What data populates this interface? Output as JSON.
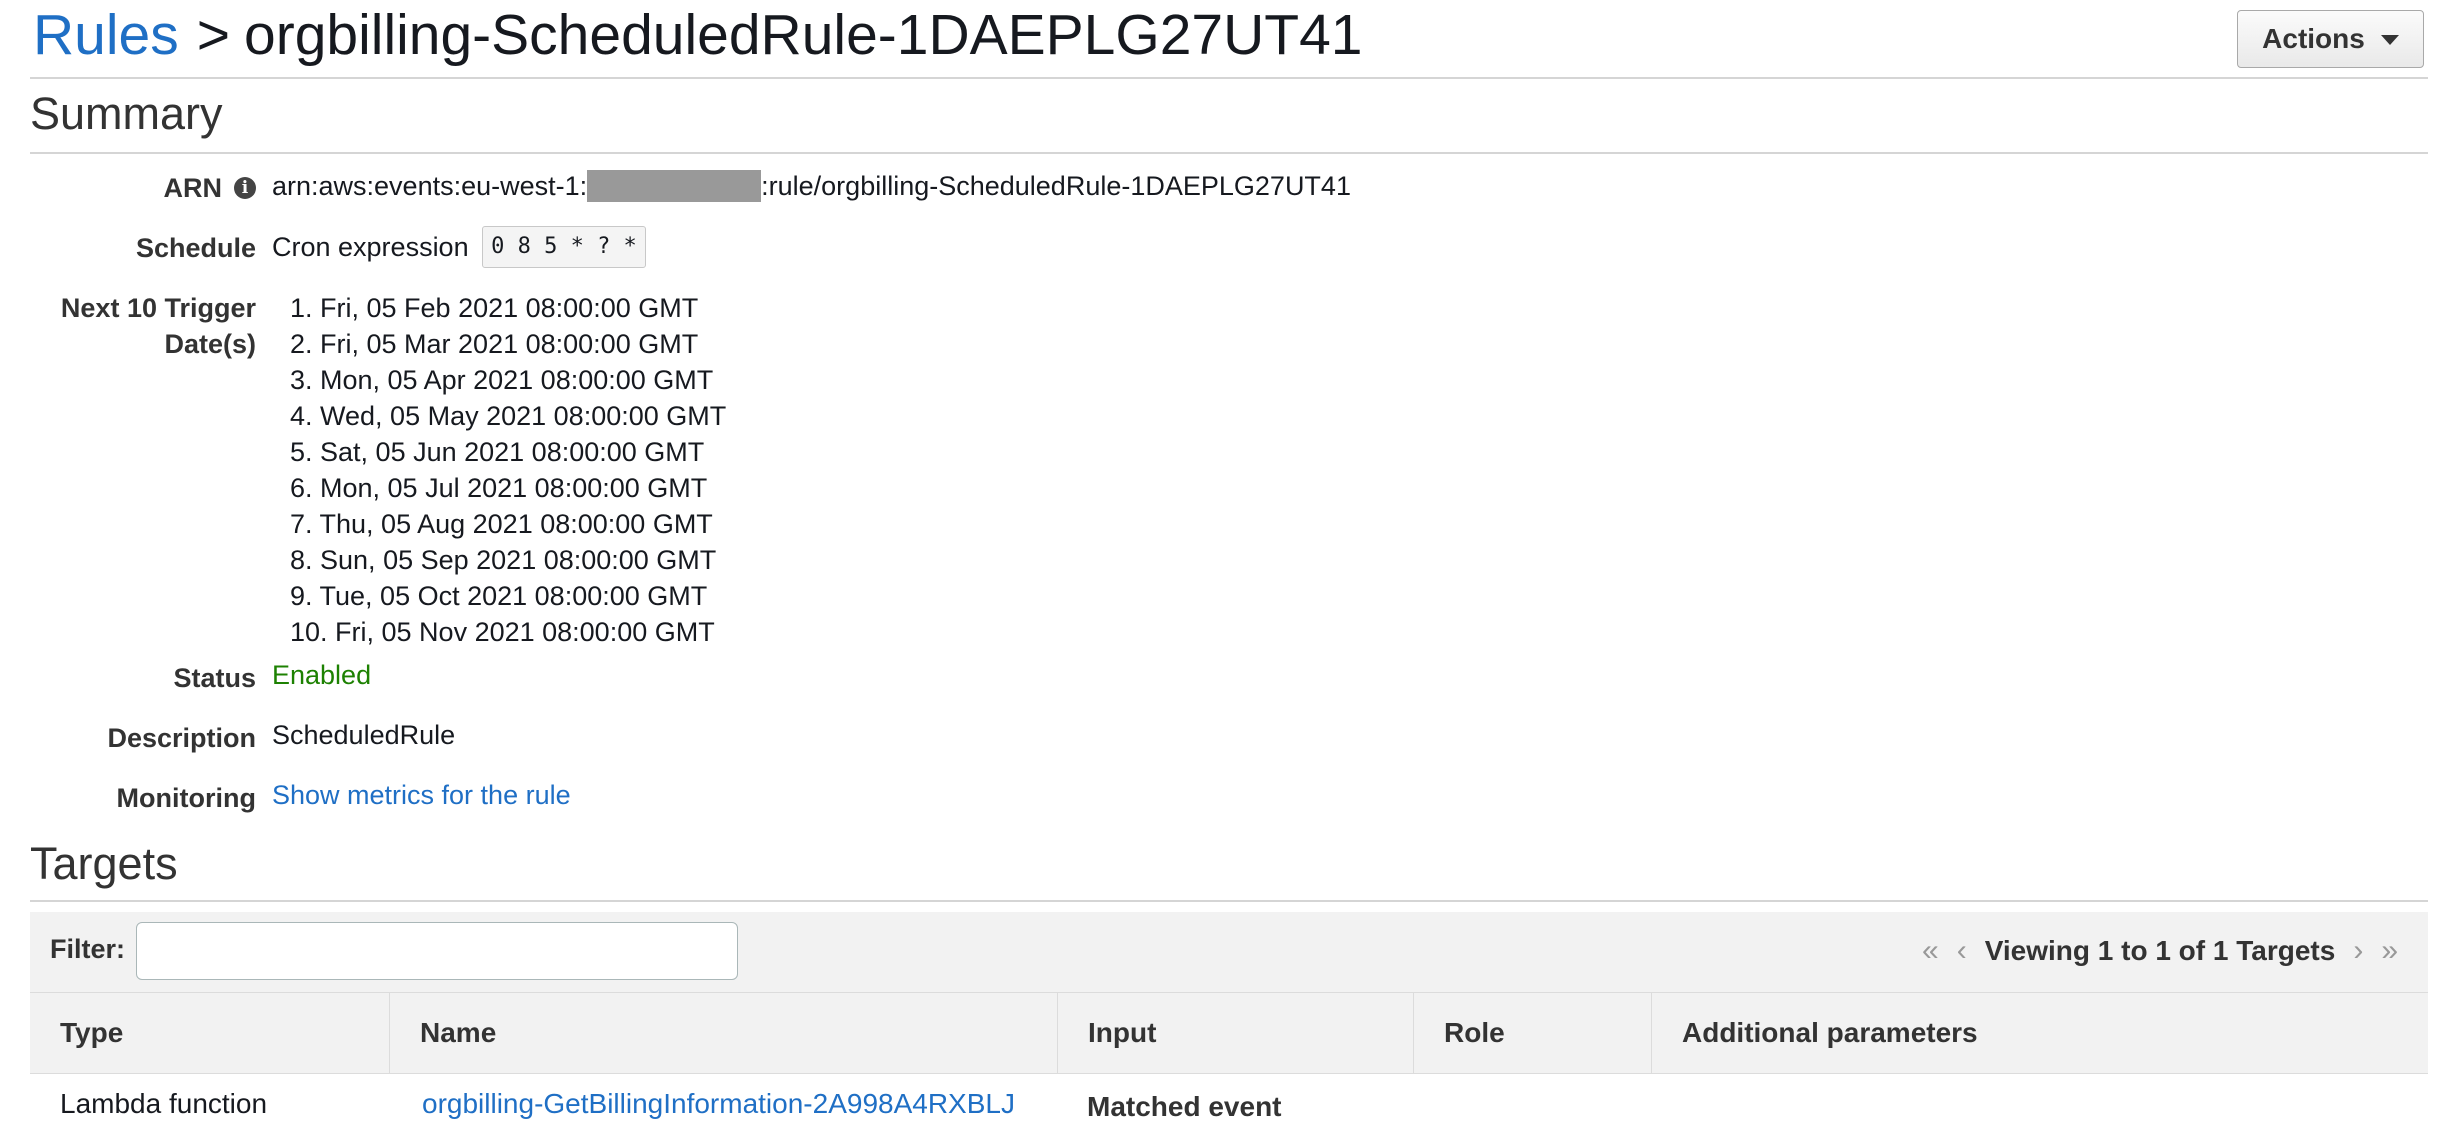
{
  "header": {
    "breadcrumb_root": "Rules",
    "breadcrumb_separator": ">",
    "rule_name": "orgbilling-ScheduledRule-1DAEPLG27UT41",
    "actions_label": "Actions"
  },
  "summary": {
    "title": "Summary",
    "arn": {
      "label": "ARN",
      "prefix": "arn:aws:events:eu-west-1:",
      "suffix": ":rule/orgbilling-ScheduledRule-1DAEPLG27UT41"
    },
    "schedule": {
      "label": "Schedule",
      "text": "Cron expression",
      "cron": "0 8 5 * ? *"
    },
    "triggers": {
      "label_line1": "Next 10 Trigger",
      "label_line2": "Date(s)",
      "dates": [
        "1. Fri, 05 Feb 2021 08:00:00 GMT",
        "2. Fri, 05 Mar 2021 08:00:00 GMT",
        "3. Mon, 05 Apr 2021 08:00:00 GMT",
        "4. Wed, 05 May 2021 08:00:00 GMT",
        "5. Sat, 05 Jun 2021 08:00:00 GMT",
        "6. Mon, 05 Jul 2021 08:00:00 GMT",
        "7. Thu, 05 Aug 2021 08:00:00 GMT",
        "8. Sun, 05 Sep 2021 08:00:00 GMT",
        "9. Tue, 05 Oct 2021 08:00:00 GMT",
        "10. Fri, 05 Nov 2021 08:00:00 GMT"
      ]
    },
    "status": {
      "label": "Status",
      "value": "Enabled"
    },
    "description": {
      "label": "Description",
      "value": "ScheduledRule"
    },
    "monitoring": {
      "label": "Monitoring",
      "link": "Show metrics for the rule"
    }
  },
  "targets": {
    "title": "Targets",
    "filter_label": "Filter:",
    "filter_value": "",
    "pager_text": "Viewing 1 to 1 of 1 Targets",
    "columns": [
      "Type",
      "Name",
      "Input",
      "Role",
      "Additional parameters"
    ],
    "rows": [
      {
        "type": "Lambda function",
        "name": "orgbilling-GetBillingInformation-2A998A4RXBLJ",
        "input": "Matched event",
        "role": "",
        "additional": ""
      }
    ]
  },
  "icons": {
    "info": "info-icon",
    "caret": "caret-down-icon",
    "first_page": "double-chevron-left-icon",
    "prev_page": "chevron-left-icon",
    "next_page": "chevron-right-icon",
    "last_page": "double-chevron-right-icon"
  },
  "colors": {
    "link": "#1f6fc5",
    "enabled": "#1d8102",
    "redacted": "#999999"
  }
}
